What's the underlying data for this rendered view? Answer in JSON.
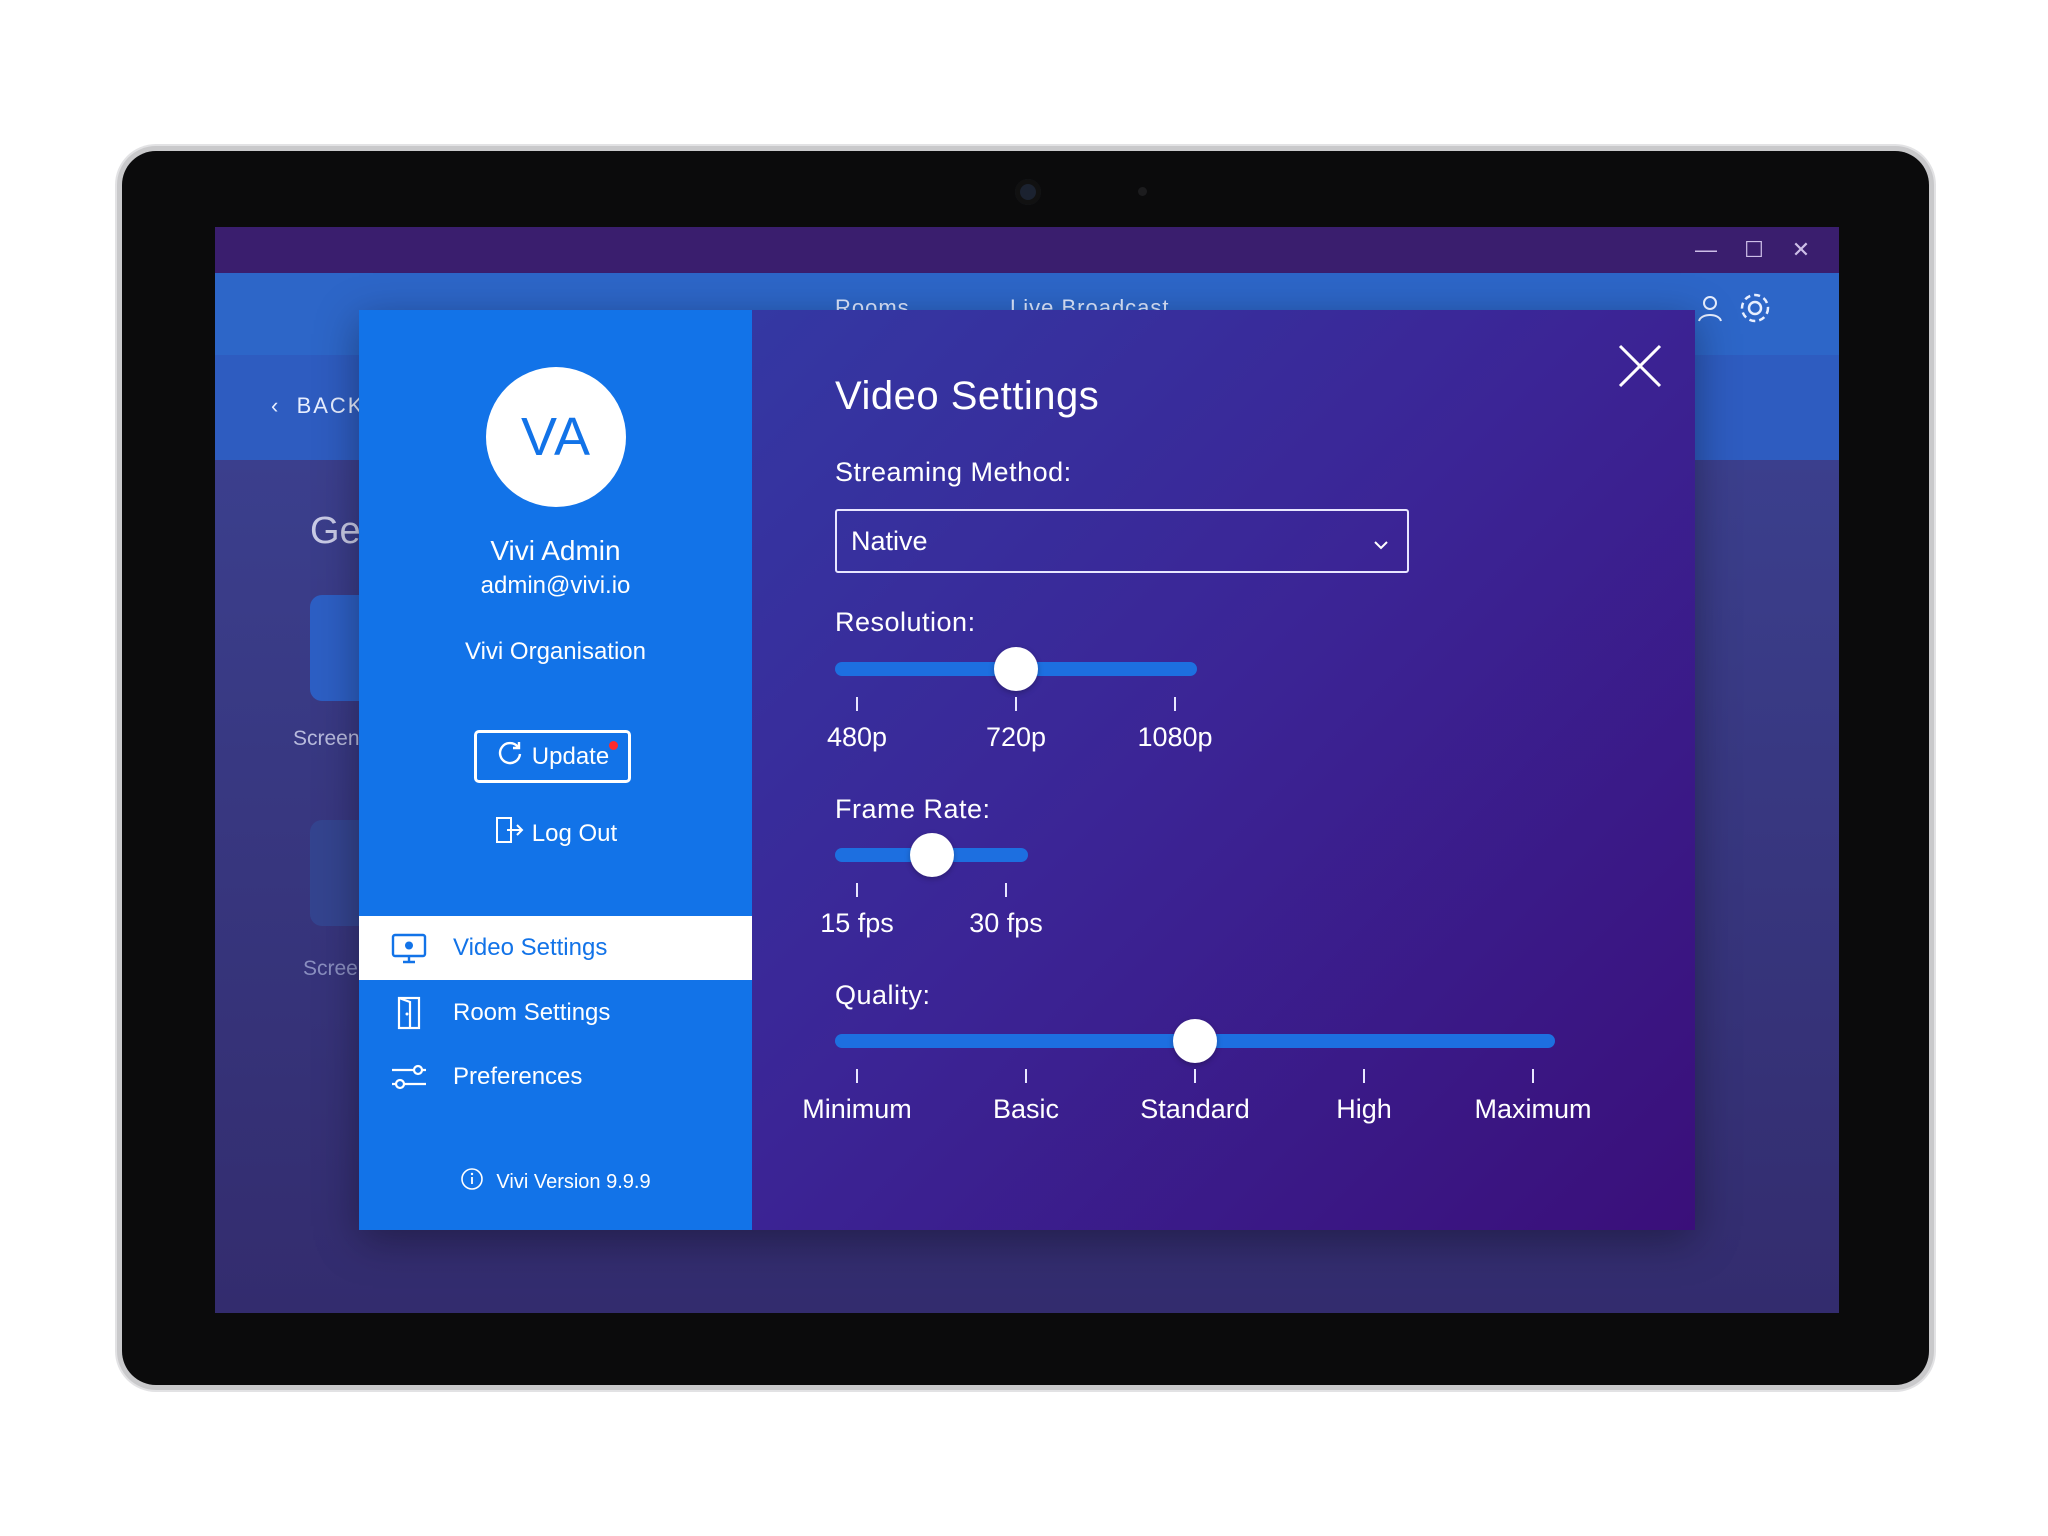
{
  "window": {
    "controls": [
      "—",
      "☐",
      "✕"
    ]
  },
  "nav": {
    "rooms": "Rooms",
    "live_broadcast": "Live Broadcast"
  },
  "subbar": {
    "back_label": "BACK"
  },
  "background": {
    "heading": "Ge",
    "tile1_caption": "Screen",
    "tile2_caption": "Scree"
  },
  "sidebar": {
    "avatar_initials": "VA",
    "user_name": "Vivi Admin",
    "user_email": "admin@vivi.io",
    "organisation": "Vivi Organisation",
    "update_label": "Update",
    "logout_label": "Log Out",
    "menu": [
      {
        "label": "Video Settings",
        "icon": "monitor-gear-icon",
        "active": true
      },
      {
        "label": "Room Settings",
        "icon": "door-icon",
        "active": false
      },
      {
        "label": "Preferences",
        "icon": "sliders-icon",
        "active": false
      }
    ],
    "version": "Vivi Version 9.9.9"
  },
  "content": {
    "title": "Video Settings",
    "streaming_method": {
      "label": "Streaming Method:",
      "value": "Native"
    },
    "resolution": {
      "label": "Resolution:",
      "options": [
        "480p",
        "720p",
        "1080p"
      ],
      "selected_index": 1
    },
    "frame_rate": {
      "label": "Frame Rate:",
      "options": [
        "15 fps",
        "30 fps"
      ],
      "selected_index": 0.5
    },
    "quality": {
      "label": "Quality:",
      "options": [
        "Minimum",
        "Basic",
        "Standard",
        "High",
        "Maximum"
      ],
      "selected_index": 2
    }
  },
  "colors": {
    "sidebar": "#1273e8",
    "accent_track": "#1d6fe0",
    "update_dot": "#ff2a2a"
  }
}
